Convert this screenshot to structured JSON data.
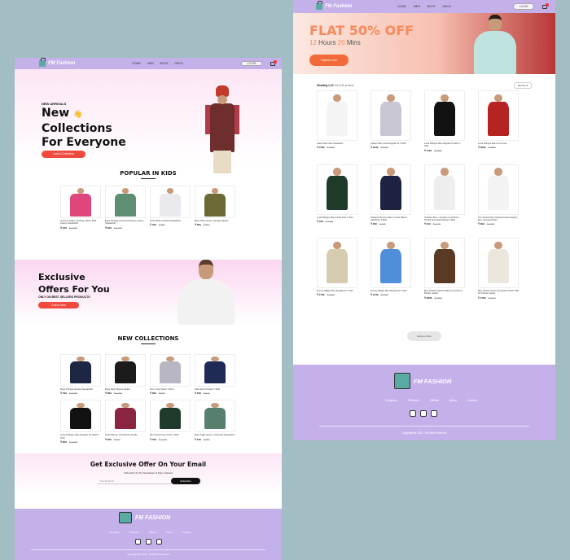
{
  "site": {
    "brand": "FM Fashion",
    "footer_brand": "FM FASHION"
  },
  "nav": {
    "items": [
      "HOME",
      "MEN",
      "BOYS",
      "GIRLS"
    ],
    "login": "LOGIN"
  },
  "hero": {
    "tag": "NEW ARRIVALS",
    "line1": "New",
    "wave": "👋",
    "line2": "Collections",
    "line3": "For Everyone",
    "button": "Latest Collection"
  },
  "kids": {
    "title": "POPULAR IN KIDS",
    "items": [
      {
        "name": "Juniors Ladies Clothing Cotton Pink Fleece Sweatshirt",
        "price": "₹ 349",
        "old": "₹ 1,087",
        "color": "#e0467b"
      },
      {
        "name": "Boys Vintage Crewneck Fleece Green Sweatshirt",
        "price": "₹ 849",
        "old": "₹ 1,049",
        "color": "#5f8f73"
      },
      {
        "name": "Girls White Hooded Sweatshirt",
        "price": "₹ 499",
        "old": "₹ 699",
        "color": "#e9e9ee"
      },
      {
        "name": "Boys Olive Green Hooded Jacket",
        "price": "₹ 569",
        "old": "₹ 899",
        "color": "#6b6a37"
      }
    ]
  },
  "offer": {
    "line1": "Exclusive",
    "line2": "Offers For You",
    "sub": "ONLY ON BEST SELLERS PRODUCTS",
    "button": "Check Now"
  },
  "new_collections": {
    "title": "NEW COLLECTIONS",
    "items": [
      {
        "name": "Boys Printed Hooded Sweatshirt",
        "price": "₹ 549",
        "old": "₹ 1,099",
        "color": "#1d2642"
      },
      {
        "name": "Boys Red Striped Jacket",
        "price": "₹ 699",
        "old": "₹ 1,299",
        "color": "#1b1b1b"
      },
      {
        "name": "Grey Crew Neck T-Shirt",
        "price": "₹ 299",
        "old": "₹ 599",
        "color": "#b9b6c4"
      },
      {
        "name": "Kids Navy Printed T-Shirt",
        "price": "₹ 349",
        "old": "₹ 649",
        "color": "#1f2a55"
      },
      {
        "name": "Louis Philippe Men Regular Fit Solid T-Shirt",
        "price": "₹ 999",
        "old": "₹ 1,599",
        "color": "#121212"
      },
      {
        "name": "Girls Maroon Colorblock Hoodie",
        "price": "₹ 599",
        "old": "₹ 999",
        "color": "#8a2540"
      },
      {
        "name": "Men Dark Green Polo T-Shirt",
        "price": "₹ 799",
        "old": "₹ 1,199",
        "color": "#1f3b2c"
      },
      {
        "name": "Boys Sage Green Crewneck Sweatshirt",
        "price": "₹ 549",
        "old": "₹ 899",
        "color": "#56806d"
      }
    ]
  },
  "subscribe": {
    "title": "Get Exclusive Offer On Your Email",
    "sub": "Subscribe To Our Newsletter & Stay Updated",
    "placeholder": "Your Email Id",
    "button": "Subscribe"
  },
  "footer": {
    "links": [
      "Company",
      "Products",
      "Offices",
      "About",
      "Contact"
    ],
    "copyright": "Copyright @ 2023 - All Right Reserved"
  },
  "banner": {
    "title": "FLAT 50% OFF",
    "hours": "12",
    "hours_label": "Hours",
    "mins": "20",
    "mins_label": "Mins",
    "button": "Explore now"
  },
  "shop": {
    "showing_bold": "Showing 1-12",
    "showing_rest": "out of 36 product",
    "sort": "Sort by",
    "explore_more": "Explore More",
    "items": [
      {
        "name": "Calvin Klein Men Sweatshirt",
        "price": "₹ 4799",
        "old": "₹ 7999",
        "color": "#f4f4f4"
      },
      {
        "name": "Classic Men's Polo Regular Fit T-Shirt",
        "price": "₹ 2242",
        "old": "₹ 3740",
        "color": "#c9c6d3"
      },
      {
        "name": "Louis Philippe Men Regular Fit Solid T-Shirt",
        "price": "₹ 1119",
        "old": "₹ 1860",
        "color": "#121212"
      },
      {
        "name": "Louis Philippe Men's Knit Coat",
        "price": "₹ 3949",
        "old": "₹ 6559",
        "color": "#b52323"
      },
      {
        "name": "Louis Philippe Men's Solid Polo T-Shirt",
        "price": "₹ 799",
        "old": "₹ 1399",
        "color": "#1f3b2c"
      },
      {
        "name": "Scotland Premium Men's Cotton Blend Solid Polo T-Shirt",
        "price": "₹ 309",
        "old": "₹ 649",
        "color": "#1c2340"
      },
      {
        "name": "Scratchy Bros - Scratchy Loud Boom Printed Oversized Flannel T-Shirt",
        "price": "₹ 619",
        "old": "₹ 1240",
        "color": "#eeeeee"
      },
      {
        "name": "The Souled Store Original Furious Dragon Men Oversized Polo",
        "price": "₹ 999",
        "old": "₹ 1499",
        "color": "#f3f3f3"
      },
      {
        "name": "Tommy Hilfiger Men Regular Fit T-Shirt",
        "price": "₹ 1799",
        "old": "₹ 3099",
        "color": "#d7cbb0"
      },
      {
        "name": "Tommy Hilfiger Men Regular Fit T-Shirt",
        "price": "₹ 1249",
        "old": "₹ 2639",
        "color": "#4f8ed8"
      },
      {
        "name": "Men Knitted Colorful Pullover Full Slv Fit Brother Jacket",
        "price": "₹ 2699",
        "old": "₹ 3999",
        "color": "#5a3a22"
      },
      {
        "name": "Men Printed Cotton Oversized Full Slv Wife Fit Pullover Jacket",
        "price": "₹ 1799",
        "old": "₹ 2199",
        "color": "#ece7dd"
      }
    ]
  }
}
